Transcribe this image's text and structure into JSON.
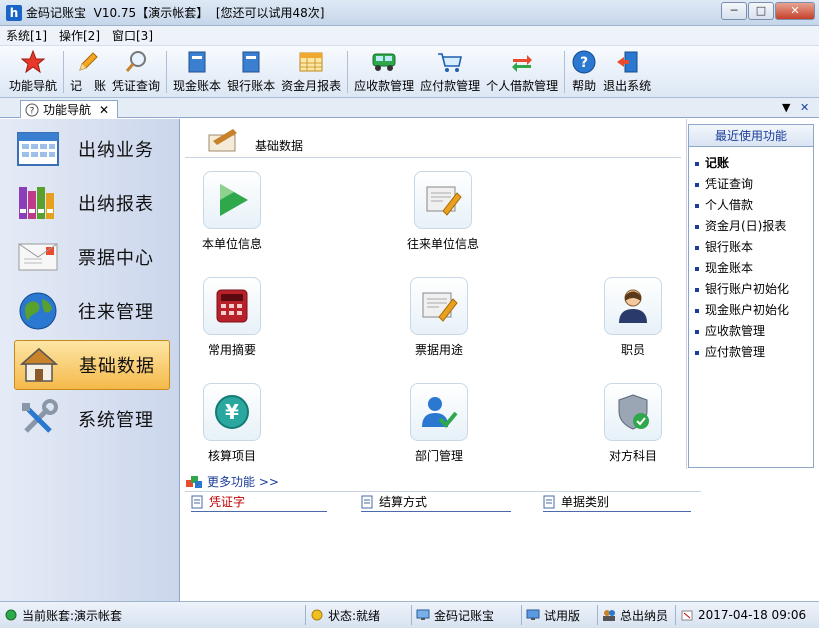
{
  "window": {
    "title": "金码记账宝  V10.75【演示帐套】  [您还可以试用48次]",
    "min_label": "─",
    "max_label": "□",
    "close_label": "✕"
  },
  "menu": [
    "系统[1]",
    "操作[2]",
    "窗口[3]"
  ],
  "toolbar": [
    {
      "label": "功能导航",
      "icon": "star-icon"
    },
    {
      "label": "记　账",
      "icon": "pencil-icon"
    },
    {
      "label": "凭证查询",
      "icon": "magnifier-icon"
    },
    {
      "label": "现金账本",
      "icon": "ledger-icon"
    },
    {
      "label": "银行账本",
      "icon": "ledger-icon"
    },
    {
      "label": "资金月报表",
      "icon": "calendar-icon"
    },
    {
      "label": "应收款管理",
      "icon": "truck-icon"
    },
    {
      "label": "应付款管理",
      "icon": "cart-icon"
    },
    {
      "label": "个人借款管理",
      "icon": "exchange-icon"
    },
    {
      "label": "帮助",
      "icon": "help-icon"
    },
    {
      "label": "退出系统",
      "icon": "exit-icon"
    }
  ],
  "tab": {
    "label": "功能导航",
    "close": "✕"
  },
  "tab_controls": {
    "dropdown": "▼",
    "close": "✕"
  },
  "sidebar": [
    {
      "label": "出纳业务",
      "icon": "calendar-grid-icon"
    },
    {
      "label": "出纳报表",
      "icon": "binders-icon"
    },
    {
      "label": "票据中心",
      "icon": "envelope-icon"
    },
    {
      "label": "往来管理",
      "icon": "globe-icon"
    },
    {
      "label": "基础数据",
      "icon": "house-icon",
      "active": true
    },
    {
      "label": "系统管理",
      "icon": "tools-icon"
    }
  ],
  "main": {
    "section_title": "基础数据",
    "functions": [
      {
        "label": "本单位信息",
        "icon": "play-icon"
      },
      {
        "label": "往来单位信息",
        "icon": "newspaper-icon"
      },
      {
        "label": "常用摘要",
        "icon": "calculator-icon"
      },
      {
        "label": "票据用途",
        "icon": "newspaper-icon"
      },
      {
        "label": "职员",
        "icon": "person-icon"
      },
      {
        "label": "核算项目",
        "icon": "yen-icon"
      },
      {
        "label": "部门管理",
        "icon": "user-check-icon"
      },
      {
        "label": "对方科目",
        "icon": "shield-icon"
      }
    ],
    "more_title": "更多功能 >>",
    "more_items": [
      "凭证字",
      "结算方式",
      "单据类别"
    ]
  },
  "recent": {
    "title": "最近使用功能",
    "items": [
      "记账",
      "凭证查询",
      "个人借款",
      "资金月(日)报表",
      "银行账本",
      "现金账本",
      "银行账户初始化",
      "现金账户初始化",
      "应收款管理",
      "应付款管理"
    ]
  },
  "status": {
    "account": "当前账套:演示帐套",
    "state": "状态:就绪",
    "app": "金码记账宝",
    "edition": "试用版",
    "user": "总出纳员",
    "datetime": "2017-04-18 09:06"
  }
}
